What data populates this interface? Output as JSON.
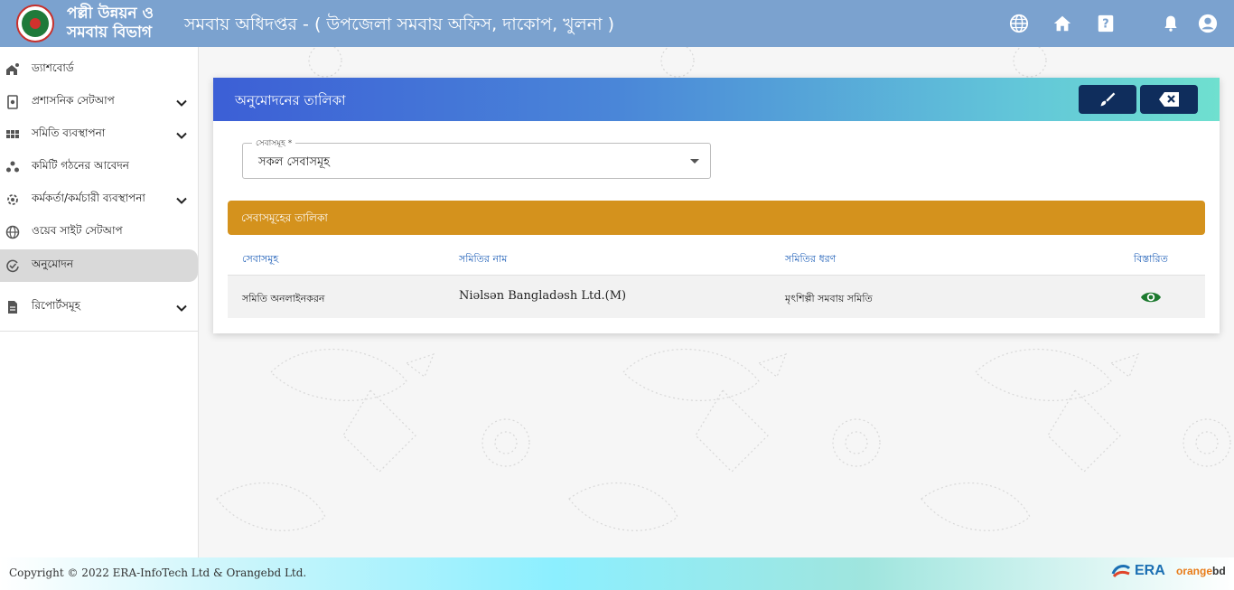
{
  "header": {
    "org_line1": "পল্লী উন্নয়ন ও",
    "org_line2": "সমবায় বিভাগ",
    "title": "সমবায় অধিদপ্তর - ( উপজেলা সমবায় অফিস, দাকোপ, খুলনা )",
    "icons": [
      "globe-icon",
      "home-icon",
      "help-icon",
      "bell-icon",
      "user-icon"
    ]
  },
  "sidebar": {
    "items": [
      {
        "label": "ড্যাশবোর্ড",
        "icon": "dashboard-icon"
      },
      {
        "label": "প্রশাসনিক সেটআপ",
        "icon": "admin-setup-icon"
      },
      {
        "label": "সমিতি ব্যবস্থাপনা",
        "icon": "grid-icon"
      },
      {
        "label": "কমিটি গঠনের আবেদন",
        "icon": "committee-icon"
      },
      {
        "label": "কর্মকর্তা/কর্মচারী ব্যবস্থাপনা",
        "icon": "staff-icon"
      },
      {
        "label": "ওয়েব সাইট সেটআপ",
        "icon": "website-icon"
      },
      {
        "label": "অনুমোদন",
        "icon": "approval-icon"
      },
      {
        "label": "রিপোর্টসমূহ",
        "icon": "report-icon"
      }
    ]
  },
  "card": {
    "title": "অনুমোদনের তালিকা",
    "service_field": {
      "label": "সেবাসমূহ *",
      "value": "সকল সেবাসমূহ"
    },
    "list_title": "সেবাসমূহের তালিকা",
    "columns": [
      "সেবাসমূহ",
      "সমিতির নাম",
      "সমিতির ধরণ",
      "বিস্তারিত"
    ],
    "rows": [
      {
        "service": "সমিতি অনলাইনকরন",
        "name": "Niəlsən Bangladəsh Ltd.(M)",
        "type": "মৃৎশিল্পী সমবায় সমিতি"
      }
    ]
  },
  "footer": {
    "copyright": "Copyright © 2022 ERA-InfoTech Ltd & Orangebd Ltd.",
    "era": "ERA",
    "orange_a": "orange",
    "orange_b": "bd"
  },
  "colors": {
    "header": "#7ba2cf",
    "list_header": "#d4921d",
    "icon_button": "#0f2d5c",
    "link": "#1e5fb8",
    "eye": "#1d7a2f"
  }
}
